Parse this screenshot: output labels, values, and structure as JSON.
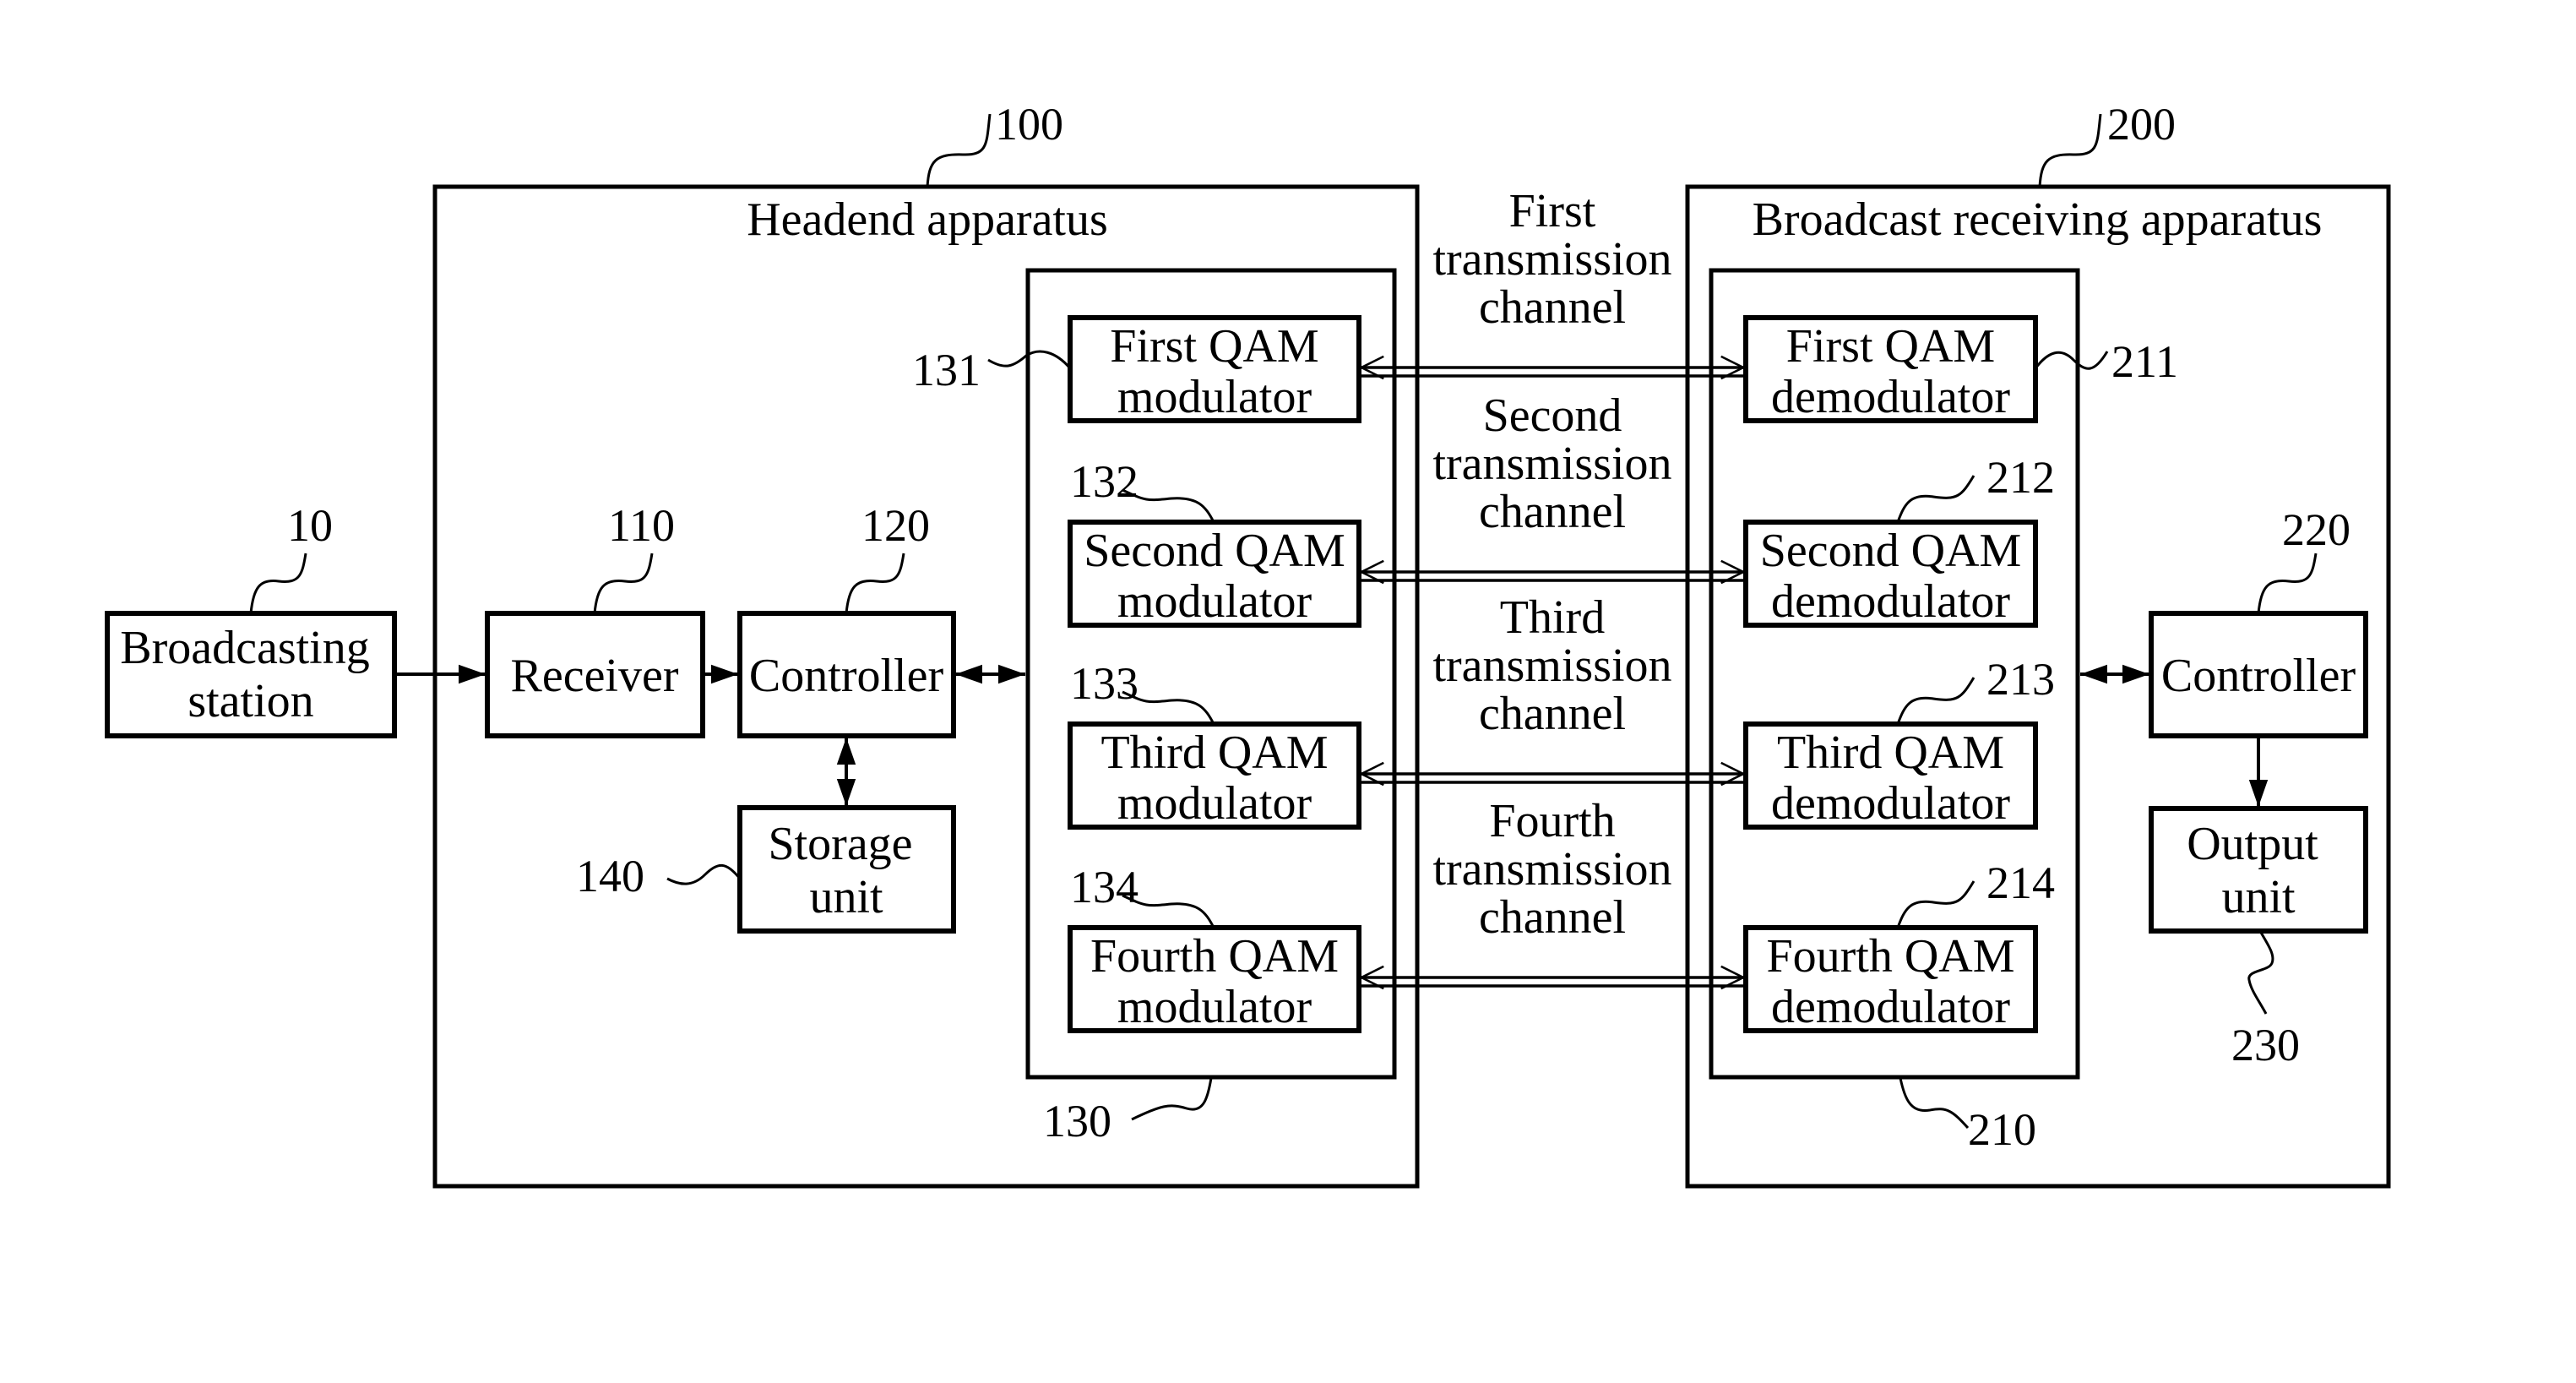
{
  "figure": {
    "type": "block-diagram",
    "description": "Cable broadcasting system with headend apparatus and broadcast receiving apparatus"
  },
  "broadcasting_station": {
    "ref": "10",
    "label_lines": [
      "Broadcasting",
      "station"
    ]
  },
  "headend": {
    "ref": "100",
    "title": "Headend apparatus",
    "receiver": {
      "ref": "110",
      "label_lines": [
        "Receiver"
      ]
    },
    "controller": {
      "ref": "120",
      "label_lines": [
        "Controller"
      ]
    },
    "storage": {
      "ref": "140",
      "label_lines": [
        "Storage",
        "unit"
      ]
    },
    "modulator_group": {
      "ref": "130"
    },
    "modulators": [
      {
        "ref": "131",
        "label_lines": [
          "First QAM",
          "modulator"
        ]
      },
      {
        "ref": "132",
        "label_lines": [
          "Second QAM",
          "modulator"
        ]
      },
      {
        "ref": "133",
        "label_lines": [
          "Third QAM",
          "modulator"
        ]
      },
      {
        "ref": "134",
        "label_lines": [
          "Fourth QAM",
          "modulator"
        ]
      }
    ]
  },
  "channels": [
    {
      "label_lines": [
        "First",
        "transmission",
        "channel"
      ]
    },
    {
      "label_lines": [
        "Second",
        "transmission",
        "channel"
      ]
    },
    {
      "label_lines": [
        "Third",
        "transmission",
        "channel"
      ]
    },
    {
      "label_lines": [
        "Fourth",
        "transmission",
        "channel"
      ]
    }
  ],
  "receiving": {
    "ref": "200",
    "title": "Broadcast receiving apparatus",
    "demodulator_group": {
      "ref": "210"
    },
    "demodulators": [
      {
        "ref": "211",
        "label_lines": [
          "First QAM",
          "demodulator"
        ]
      },
      {
        "ref": "212",
        "label_lines": [
          "Second QAM",
          "demodulator"
        ]
      },
      {
        "ref": "213",
        "label_lines": [
          "Third QAM",
          "demodulator"
        ]
      },
      {
        "ref": "214",
        "label_lines": [
          "Fourth QAM",
          "demodulator"
        ]
      }
    ],
    "controller": {
      "ref": "220",
      "label_lines": [
        "Controller"
      ]
    },
    "output": {
      "ref": "230",
      "label_lines": [
        "Output",
        "unit"
      ]
    }
  }
}
